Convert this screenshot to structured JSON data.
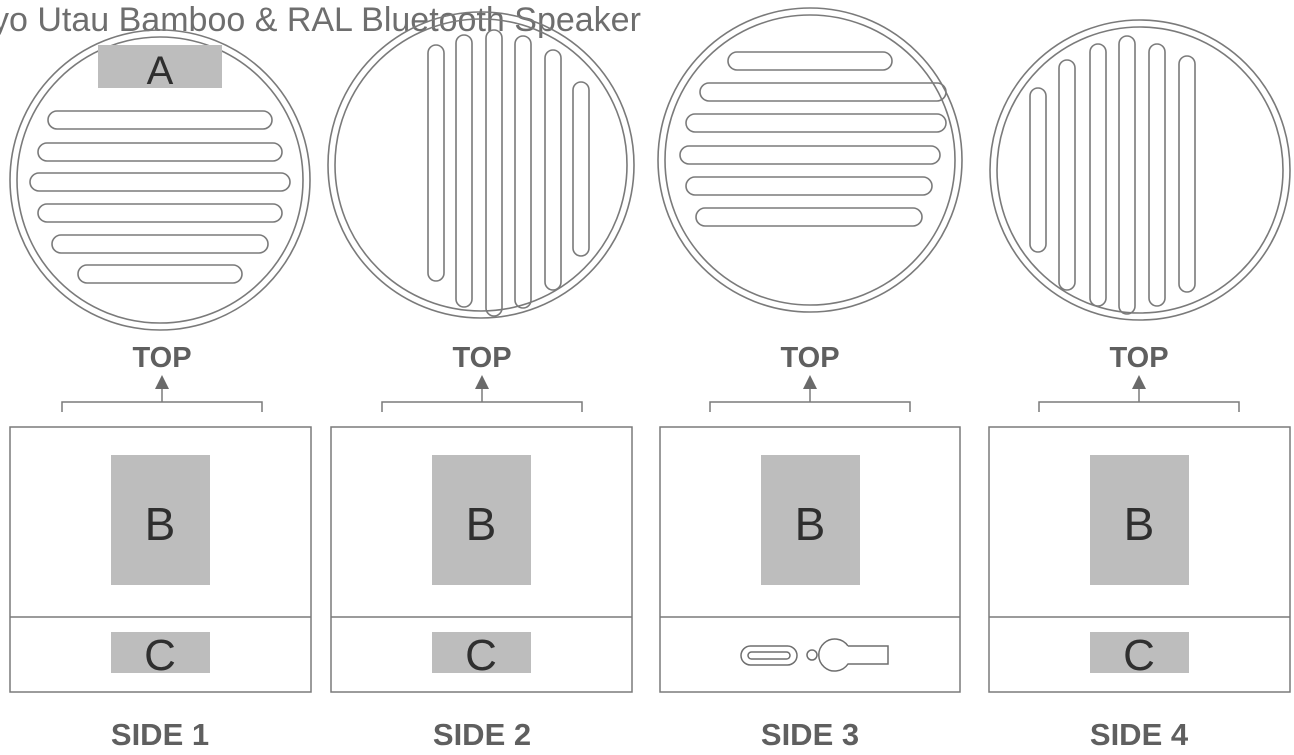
{
  "title": "yo Utau Bamboo & RAL Bluetooth Speaker",
  "top_label": "TOP",
  "zones": {
    "a": "A",
    "b": "B",
    "c": "C"
  },
  "sides": [
    {
      "label": "SIDE 1",
      "grille": "horizontal",
      "bottom": "zone"
    },
    {
      "label": "SIDE 2",
      "grille": "vertical",
      "bottom": "zone"
    },
    {
      "label": "SIDE 3",
      "grille": "horizontal",
      "bottom": "ports"
    },
    {
      "label": "SIDE 4",
      "grille": "vertical",
      "bottom": "zone"
    }
  ],
  "colors": {
    "line": "#7a7a7a",
    "zone_fill": "#bdbdbd",
    "label": "#5f5f5f"
  }
}
